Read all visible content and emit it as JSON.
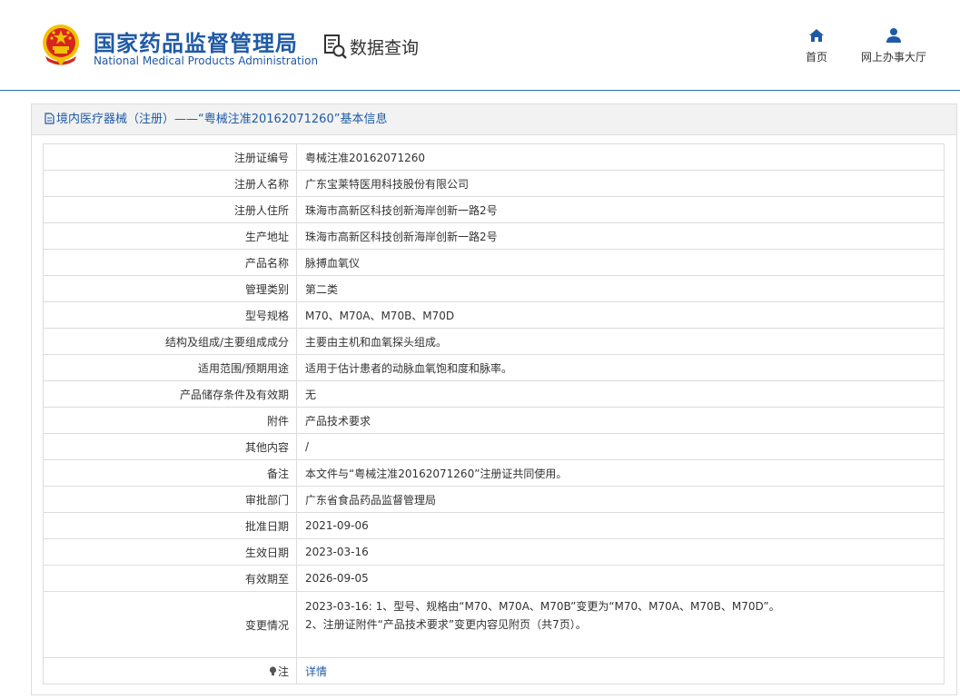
{
  "header": {
    "logo_cn": "国家药品监督管理局",
    "logo_en": "National Medical Products Administration",
    "data_query": "数据查询",
    "nav": [
      {
        "label": "首页",
        "icon": "home-icon"
      },
      {
        "label": "网上办事大厅",
        "icon": "user-icon"
      }
    ]
  },
  "panel": {
    "title": "境内医疗器械（注册）——“粤械注准20162071260”基本信息",
    "rows": [
      {
        "label": "注册证编号",
        "value": "粤械注准20162071260"
      },
      {
        "label": "注册人名称",
        "value": "广东宝莱特医用科技股份有限公司"
      },
      {
        "label": "注册人住所",
        "value": "珠海市高新区科技创新海岸创新一路2号"
      },
      {
        "label": "生产地址",
        "value": "珠海市高新区科技创新海岸创新一路2号"
      },
      {
        "label": "产品名称",
        "value": "脉搏血氧仪"
      },
      {
        "label": "管理类别",
        "value": "第二类"
      },
      {
        "label": "型号规格",
        "value": "M70、M70A、M70B、M70D"
      },
      {
        "label": "结构及组成/主要组成成分",
        "value": "主要由主机和血氧探头组成。"
      },
      {
        "label": "适用范围/预期用途",
        "value": "适用于估计患者的动脉血氧饱和度和脉率。"
      },
      {
        "label": "产品储存条件及有效期",
        "value": "无"
      },
      {
        "label": "附件",
        "value": "产品技术要求"
      },
      {
        "label": "其他内容",
        "value": "/"
      },
      {
        "label": "备注",
        "value": "本文件与“粤械注准20162071260”注册证共同使用。"
      },
      {
        "label": "审批部门",
        "value": "广东省食品药品监督管理局"
      },
      {
        "label": "批准日期",
        "value": "2021-09-06"
      },
      {
        "label": "生效日期",
        "value": "2023-03-16"
      },
      {
        "label": "有效期至",
        "value": "2026-09-05"
      }
    ],
    "change": {
      "label": "变更情况",
      "line1": "2023-03-16: 1、型号、规格由“M70、M70A、M70B”变更为“M70、M70A、M70B、M70D”。",
      "line2": "2、注册证附件“产品技术要求”变更内容见附页（共7页）。"
    },
    "note": {
      "label": "注",
      "link": "详情"
    }
  },
  "colors": {
    "brand_blue": "#1f5aa6",
    "emblem_red": "#d7261e",
    "emblem_gold": "#f2c200"
  }
}
